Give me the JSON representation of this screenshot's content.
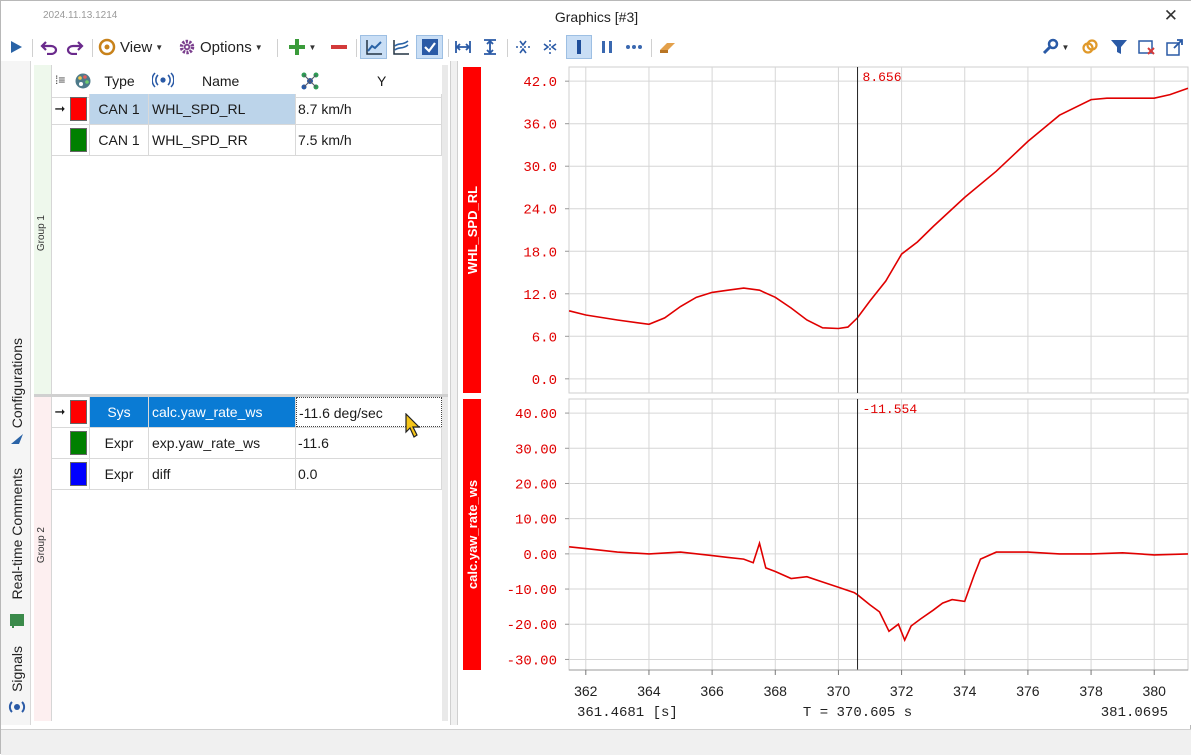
{
  "window": {
    "build_date": "2024.11.13.1214",
    "title": "Graphics [#3]",
    "close_glyph": "✕"
  },
  "toolbar": {
    "view_label": "View",
    "options_label": "Options",
    "icons": [
      "play-icon",
      "undo-icon",
      "redo-icon",
      "view-icon",
      "options-gear-icon",
      "add-icon",
      "remove-icon",
      "line-chart-icon",
      "stacked-chart-icon",
      "checkbox-icon",
      "fit-x-icon",
      "fit-y-icon",
      "cursor-icon",
      "cursor2-icon",
      "bar-cursor-icon",
      "pause-icon",
      "more-icon",
      "eraser-icon",
      "wrench-icon",
      "link-icon",
      "filter-icon",
      "clear-filter-icon",
      "export-icon"
    ]
  },
  "side_tabs": {
    "configurations": "Configurations",
    "comments": "Real-time Comments",
    "signals": "Signals"
  },
  "table_header": {
    "type": "Type",
    "name": "Name",
    "y": "Y"
  },
  "groups": [
    {
      "label": "Group 1",
      "rows": [
        {
          "type": "CAN 1",
          "name": "WHL_SPD_RL",
          "y": "8.7 km/h",
          "color": "#ff0000",
          "marker": "➞"
        },
        {
          "type": "CAN 1",
          "name": "WHL_SPD_RR",
          "y": "7.5 km/h",
          "color": "#008000",
          "marker": ""
        }
      ]
    },
    {
      "label": "Group 2",
      "rows": [
        {
          "type": "Sys",
          "name": "calc.yaw_rate_ws",
          "y": "-11.6 deg/sec",
          "color": "#ff0000",
          "marker": "➞"
        },
        {
          "type": "Expr",
          "name": "exp.yaw_rate_ws",
          "y": "-11.6",
          "color": "#008000",
          "marker": ""
        },
        {
          "type": "Expr",
          "name": "diff",
          "y": "0.0",
          "color": "#0000ff",
          "marker": ""
        }
      ]
    }
  ],
  "chart_data": [
    {
      "type": "line",
      "ylabel": "WHL_SPD_RL",
      "ylim": [
        -2,
        44
      ],
      "yticks": [
        "42.0",
        "36.0",
        "30.0",
        "24.0",
        "18.0",
        "12.0",
        "6.0",
        "0.0"
      ],
      "cursor_value": "8.656",
      "series": [
        {
          "name": "WHL_SPD_RL",
          "color": "#e00000",
          "x": [
            361.47,
            362.0,
            363.0,
            364.0,
            364.5,
            365.0,
            365.5,
            366.0,
            366.5,
            367.0,
            367.5,
            368.0,
            368.5,
            369.0,
            369.5,
            370.0,
            370.3,
            370.6,
            371.0,
            371.5,
            372.0,
            372.5,
            373.0,
            374.0,
            375.0,
            376.0,
            377.0,
            378.0,
            378.5,
            379.0,
            380.0,
            380.5,
            381.07
          ],
          "y": [
            9.6,
            9.0,
            8.3,
            7.7,
            8.6,
            10.2,
            11.5,
            12.2,
            12.5,
            12.8,
            12.5,
            11.5,
            10.0,
            8.3,
            7.2,
            7.1,
            7.3,
            8.6,
            11.0,
            13.8,
            17.6,
            19.3,
            21.5,
            25.6,
            29.3,
            33.5,
            37.2,
            39.4,
            39.6,
            39.6,
            39.6,
            40.1,
            41.0
          ]
        }
      ]
    },
    {
      "type": "line",
      "ylabel": "calc.yaw_rate_ws",
      "ylim": [
        -33,
        44
      ],
      "yticks": [
        "40.00",
        "30.00",
        "20.00",
        "10.00",
        "0.00",
        "-10.00",
        "-20.00",
        "-30.00"
      ],
      "cursor_value": "-11.554",
      "series": [
        {
          "name": "calc.yaw_rate_ws",
          "color": "#e00000",
          "x": [
            361.47,
            362.0,
            363.0,
            364.0,
            365.0,
            366.0,
            366.5,
            367.0,
            367.3,
            367.5,
            367.7,
            368.0,
            368.5,
            369.0,
            369.5,
            370.0,
            370.5,
            370.6,
            371.0,
            371.3,
            371.6,
            371.9,
            372.1,
            372.3,
            372.6,
            373.0,
            373.3,
            373.6,
            374.0,
            374.3,
            374.5,
            375.0,
            376.0,
            377.0,
            378.0,
            379.0,
            380.0,
            381.07
          ],
          "y": [
            2.0,
            1.5,
            0.5,
            0.0,
            0.5,
            -0.5,
            -1.0,
            -1.5,
            -2.5,
            3.0,
            -4.0,
            -5.0,
            -7.0,
            -6.5,
            -8.0,
            -9.5,
            -11.0,
            -11.6,
            -14.5,
            -16.5,
            -22.0,
            -20.0,
            -24.5,
            -20.5,
            -18.5,
            -16.0,
            -14.0,
            -13.0,
            -13.5,
            -6.0,
            -1.5,
            0.5,
            0.5,
            0.0,
            0.0,
            0.3,
            -0.3,
            0.0
          ]
        }
      ]
    }
  ],
  "x_axis": {
    "ticks": [
      "362",
      "364",
      "366",
      "368",
      "370",
      "372",
      "374",
      "376",
      "378",
      "380"
    ],
    "start_label": "361.4681 [s]",
    "cursor_label": "T = 370.605 s",
    "end_label": "381.0695",
    "xlim": [
      361.4681,
      381.0695
    ],
    "cursor_x": 370.605
  }
}
